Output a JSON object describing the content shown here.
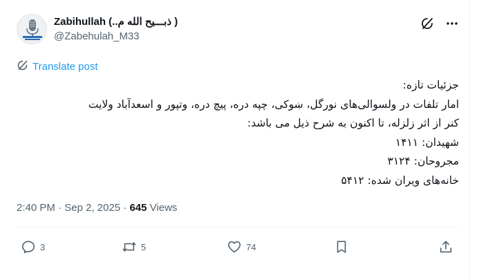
{
  "author": {
    "display_name": "Zabihullah (..ذبـــیح الله م )",
    "handle": "@Zabehulah_M33"
  },
  "header": {
    "grok_icon": "grok-icon",
    "more_icon": "more-icon"
  },
  "translate": {
    "label": "Translate post",
    "icon": "translate-icon"
  },
  "tweet": {
    "lines": [
      "جزئیات تازه:",
      "امار تلفات در ولسوالی‌های نورگل، ښوکی، چپه دره، پیچ دره، وتپور و اسعدآباد ولایت",
      "کنر از اثر زلزله، تا اکنون به شرح ذیل می باشد:",
      "شهیدان: ۱۴۱۱",
      "مجروحان: ۳۱۲۴",
      "خانه‌های ویران شده: ۵۴۱۲"
    ]
  },
  "meta": {
    "time": "2:40 PM",
    "sep1": " · ",
    "date": "Sep 2, 2025",
    "sep2": " · ",
    "views_count": "645",
    "views_label": " Views"
  },
  "actions": {
    "replies": "3",
    "reposts": "5",
    "likes": "74",
    "icons": [
      "reply-icon",
      "repost-icon",
      "like-icon",
      "bookmark-icon",
      "share-icon"
    ]
  },
  "colors": {
    "link": "#1d9bf0",
    "muted": "#536471",
    "text": "#0f1419",
    "border": "#eff3f4"
  }
}
